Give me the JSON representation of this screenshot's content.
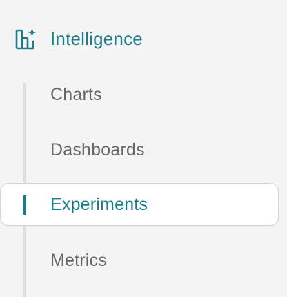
{
  "section": {
    "label": "Intelligence",
    "icon": "intelligence-chart-sparkle-icon"
  },
  "items": [
    {
      "label": "Charts",
      "active": false
    },
    {
      "label": "Dashboards",
      "active": false
    },
    {
      "label": "Experiments",
      "active": true
    },
    {
      "label": "Metrics",
      "active": false
    }
  ],
  "colors": {
    "accent": "#1a7d8a",
    "text": "#666666",
    "background": "#f4f4f4",
    "rail": "#dedede"
  }
}
